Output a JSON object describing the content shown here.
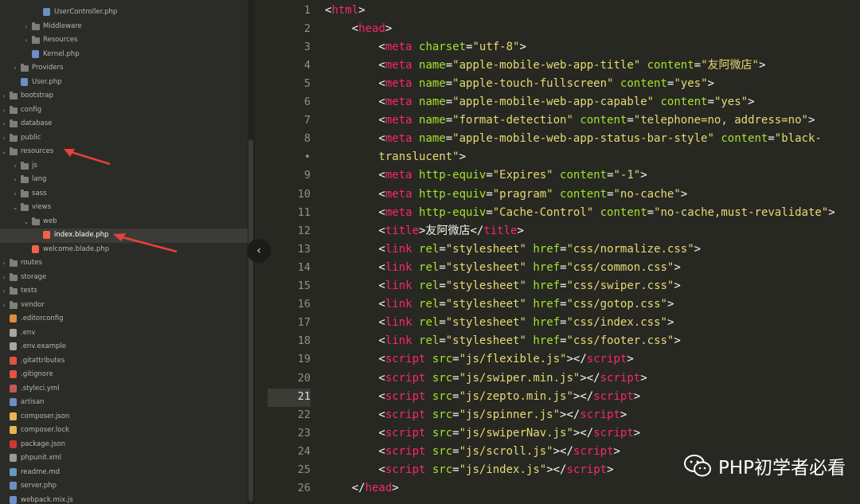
{
  "sidebar": {
    "items": [
      {
        "label": "UserController.php",
        "icon": "php-file-icon",
        "indent": 4,
        "arrow": "",
        "selected": false
      },
      {
        "label": "Middleware",
        "icon": "folder-icon",
        "indent": 3,
        "arrow": "right",
        "selected": false
      },
      {
        "label": "Resources",
        "icon": "folder-icon",
        "indent": 3,
        "arrow": "right",
        "selected": false
      },
      {
        "label": "Kernel.php",
        "icon": "php-file-icon",
        "indent": 3,
        "arrow": "",
        "selected": false
      },
      {
        "label": "Providers",
        "icon": "folder-icon",
        "indent": 2,
        "arrow": "right",
        "selected": false
      },
      {
        "label": "User.php",
        "icon": "php-file-icon",
        "indent": 2,
        "arrow": "",
        "selected": false
      },
      {
        "label": "bootstrap",
        "icon": "folder-icon",
        "indent": 1,
        "arrow": "right",
        "selected": false
      },
      {
        "label": "config",
        "icon": "folder-icon",
        "indent": 1,
        "arrow": "right",
        "selected": false
      },
      {
        "label": "database",
        "icon": "folder-icon",
        "indent": 1,
        "arrow": "right",
        "selected": false
      },
      {
        "label": "public",
        "icon": "folder-icon",
        "indent": 1,
        "arrow": "right",
        "selected": false
      },
      {
        "label": "resources",
        "icon": "folder-icon",
        "indent": 1,
        "arrow": "down",
        "selected": false
      },
      {
        "label": "js",
        "icon": "folder-icon",
        "indent": 2,
        "arrow": "right",
        "selected": false
      },
      {
        "label": "lang",
        "icon": "folder-icon",
        "indent": 2,
        "arrow": "right",
        "selected": false
      },
      {
        "label": "sass",
        "icon": "folder-icon",
        "indent": 2,
        "arrow": "right",
        "selected": false
      },
      {
        "label": "views",
        "icon": "folder-icon",
        "indent": 2,
        "arrow": "down",
        "selected": false
      },
      {
        "label": "web",
        "icon": "folder-icon",
        "indent": 3,
        "arrow": "down",
        "selected": false
      },
      {
        "label": "index.blade.php",
        "icon": "blade-file-icon",
        "indent": 4,
        "arrow": "",
        "selected": true
      },
      {
        "label": "welcome.blade.php",
        "icon": "blade-file-icon",
        "indent": 3,
        "arrow": "",
        "selected": false
      },
      {
        "label": "routes",
        "icon": "folder-icon",
        "indent": 1,
        "arrow": "right",
        "selected": false
      },
      {
        "label": "storage",
        "icon": "folder-icon",
        "indent": 1,
        "arrow": "right",
        "selected": false
      },
      {
        "label": "tests",
        "icon": "folder-icon",
        "indent": 1,
        "arrow": "right",
        "selected": false
      },
      {
        "label": "vendor",
        "icon": "folder-icon",
        "indent": 1,
        "arrow": "right",
        "selected": false
      },
      {
        "label": ".editorconfig",
        "icon": "editorconfig-icon",
        "indent": 1,
        "arrow": "",
        "selected": false
      },
      {
        "label": ".env",
        "icon": "gear-icon",
        "indent": 1,
        "arrow": "",
        "selected": false
      },
      {
        "label": ".env.example",
        "icon": "gear-icon",
        "indent": 1,
        "arrow": "",
        "selected": false
      },
      {
        "label": ".gitattributes",
        "icon": "git-icon",
        "indent": 1,
        "arrow": "",
        "selected": false
      },
      {
        "label": ".gitignore",
        "icon": "git-icon",
        "indent": 1,
        "arrow": "",
        "selected": false
      },
      {
        "label": ".styleci.yml",
        "icon": "yml-icon",
        "indent": 1,
        "arrow": "",
        "selected": false
      },
      {
        "label": "artisan",
        "icon": "php-file-icon",
        "indent": 1,
        "arrow": "",
        "selected": false
      },
      {
        "label": "composer.json",
        "icon": "composer-icon",
        "indent": 1,
        "arrow": "",
        "selected": false
      },
      {
        "label": "composer.lock",
        "icon": "composer-icon",
        "indent": 1,
        "arrow": "",
        "selected": false
      },
      {
        "label": "package.json",
        "icon": "npm-icon",
        "indent": 1,
        "arrow": "",
        "selected": false
      },
      {
        "label": "phpunit.xml",
        "icon": "xml-icon",
        "indent": 1,
        "arrow": "",
        "selected": false
      },
      {
        "label": "readme.md",
        "icon": "markdown-icon",
        "indent": 1,
        "arrow": "",
        "selected": false
      },
      {
        "label": "server.php",
        "icon": "php-file-icon",
        "indent": 1,
        "arrow": "",
        "selected": false
      },
      {
        "label": "webpack.mix.js",
        "icon": "php-file-icon",
        "indent": 1,
        "arrow": "",
        "selected": false
      }
    ]
  },
  "editor": {
    "current_line": "21",
    "line_numbers": [
      "1",
      "2",
      "3",
      "4",
      "5",
      "6",
      "7",
      "8",
      "•",
      "9",
      "10",
      "11",
      "12",
      "13",
      "14",
      "15",
      "16",
      "17",
      "18",
      "19",
      "20",
      "21",
      "22",
      "23",
      "24",
      "25",
      "26"
    ],
    "lines": [
      [
        [
          "p",
          "<"
        ],
        [
          "t",
          "html"
        ],
        [
          "p",
          ">"
        ]
      ],
      [
        [
          "p",
          "    <"
        ],
        [
          "t",
          "head"
        ],
        [
          "p",
          ">"
        ]
      ],
      [
        [
          "p",
          "        <"
        ],
        [
          "t",
          "meta"
        ],
        [
          "p",
          " "
        ],
        [
          "a",
          "charset"
        ],
        [
          "p",
          "="
        ],
        [
          "s",
          "\"utf-8\""
        ],
        [
          "p",
          ">"
        ]
      ],
      [
        [
          "p",
          "        <"
        ],
        [
          "t",
          "meta"
        ],
        [
          "p",
          " "
        ],
        [
          "a",
          "name"
        ],
        [
          "p",
          "="
        ],
        [
          "s",
          "\"apple-mobile-web-app-title\""
        ],
        [
          "p",
          " "
        ],
        [
          "a",
          "content"
        ],
        [
          "p",
          "="
        ],
        [
          "s",
          "\"友阿微店\""
        ],
        [
          "p",
          ">"
        ]
      ],
      [
        [
          "p",
          "        <"
        ],
        [
          "t",
          "meta"
        ],
        [
          "p",
          " "
        ],
        [
          "a",
          "name"
        ],
        [
          "p",
          "="
        ],
        [
          "s",
          "\"apple-touch-fullscreen\""
        ],
        [
          "p",
          " "
        ],
        [
          "a",
          "content"
        ],
        [
          "p",
          "="
        ],
        [
          "s",
          "\"yes\""
        ],
        [
          "p",
          ">"
        ]
      ],
      [
        [
          "p",
          "        <"
        ],
        [
          "t",
          "meta"
        ],
        [
          "p",
          " "
        ],
        [
          "a",
          "name"
        ],
        [
          "p",
          "="
        ],
        [
          "s",
          "\"apple-mobile-web-app-capable\""
        ],
        [
          "p",
          " "
        ],
        [
          "a",
          "content"
        ],
        [
          "p",
          "="
        ],
        [
          "s",
          "\"yes\""
        ],
        [
          "p",
          ">"
        ]
      ],
      [
        [
          "p",
          "        <"
        ],
        [
          "t",
          "meta"
        ],
        [
          "p",
          " "
        ],
        [
          "a",
          "name"
        ],
        [
          "p",
          "="
        ],
        [
          "s",
          "\"format-detection\""
        ],
        [
          "p",
          " "
        ],
        [
          "a",
          "content"
        ],
        [
          "p",
          "="
        ],
        [
          "s",
          "\"telephone=no, address=no\""
        ],
        [
          "p",
          ">"
        ]
      ],
      [
        [
          "p",
          "        <"
        ],
        [
          "t",
          "meta"
        ],
        [
          "p",
          " "
        ],
        [
          "a",
          "name"
        ],
        [
          "p",
          "="
        ],
        [
          "s",
          "\"apple-mobile-web-app-status-bar-style\""
        ],
        [
          "p",
          " "
        ],
        [
          "a",
          "content"
        ],
        [
          "p",
          "="
        ],
        [
          "s",
          "\"black-"
        ]
      ],
      [
        [
          "s",
          "        translucent\""
        ],
        [
          "p",
          ">"
        ]
      ],
      [
        [
          "p",
          "        <"
        ],
        [
          "t",
          "meta"
        ],
        [
          "p",
          " "
        ],
        [
          "a",
          "http-equiv"
        ],
        [
          "p",
          "="
        ],
        [
          "s",
          "\"Expires\""
        ],
        [
          "p",
          " "
        ],
        [
          "a",
          "content"
        ],
        [
          "p",
          "="
        ],
        [
          "s",
          "\"-1\""
        ],
        [
          "p",
          ">"
        ]
      ],
      [
        [
          "p",
          "        <"
        ],
        [
          "t",
          "meta"
        ],
        [
          "p",
          " "
        ],
        [
          "a",
          "http-equiv"
        ],
        [
          "p",
          "="
        ],
        [
          "s",
          "\"pragram\""
        ],
        [
          "p",
          " "
        ],
        [
          "a",
          "content"
        ],
        [
          "p",
          "="
        ],
        [
          "s",
          "\"no-cache\""
        ],
        [
          "p",
          ">"
        ]
      ],
      [
        [
          "p",
          "        <"
        ],
        [
          "t",
          "meta"
        ],
        [
          "p",
          " "
        ],
        [
          "a",
          "http-equiv"
        ],
        [
          "p",
          "="
        ],
        [
          "s",
          "\"Cache-Control\""
        ],
        [
          "p",
          " "
        ],
        [
          "a",
          "content"
        ],
        [
          "p",
          "="
        ],
        [
          "s",
          "\"no-cache,must-revalidate\""
        ],
        [
          "p",
          ">"
        ]
      ],
      [
        [
          "p",
          "        <"
        ],
        [
          "t",
          "title"
        ],
        [
          "p",
          ">友阿微店</"
        ],
        [
          "t",
          "title"
        ],
        [
          "p",
          ">"
        ]
      ],
      [
        [
          "p",
          "        <"
        ],
        [
          "t",
          "link"
        ],
        [
          "p",
          " "
        ],
        [
          "a",
          "rel"
        ],
        [
          "p",
          "="
        ],
        [
          "s",
          "\"stylesheet\""
        ],
        [
          "p",
          " "
        ],
        [
          "a",
          "href"
        ],
        [
          "p",
          "="
        ],
        [
          "s",
          "\"css/normalize.css\""
        ],
        [
          "p",
          ">"
        ]
      ],
      [
        [
          "p",
          "        <"
        ],
        [
          "t",
          "link"
        ],
        [
          "p",
          " "
        ],
        [
          "a",
          "rel"
        ],
        [
          "p",
          "="
        ],
        [
          "s",
          "\"stylesheet\""
        ],
        [
          "p",
          " "
        ],
        [
          "a",
          "href"
        ],
        [
          "p",
          "="
        ],
        [
          "s",
          "\"css/common.css\""
        ],
        [
          "p",
          ">"
        ]
      ],
      [
        [
          "p",
          "        <"
        ],
        [
          "t",
          "link"
        ],
        [
          "p",
          " "
        ],
        [
          "a",
          "rel"
        ],
        [
          "p",
          "="
        ],
        [
          "s",
          "\"stylesheet\""
        ],
        [
          "p",
          " "
        ],
        [
          "a",
          "href"
        ],
        [
          "p",
          "="
        ],
        [
          "s",
          "\"css/swiper.css\""
        ],
        [
          "p",
          ">"
        ]
      ],
      [
        [
          "p",
          "        <"
        ],
        [
          "t",
          "link"
        ],
        [
          "p",
          " "
        ],
        [
          "a",
          "rel"
        ],
        [
          "p",
          "="
        ],
        [
          "s",
          "\"stylesheet\""
        ],
        [
          "p",
          " "
        ],
        [
          "a",
          "href"
        ],
        [
          "p",
          "="
        ],
        [
          "s",
          "\"css/gotop.css\""
        ],
        [
          "p",
          ">"
        ]
      ],
      [
        [
          "p",
          "        <"
        ],
        [
          "t",
          "link"
        ],
        [
          "p",
          " "
        ],
        [
          "a",
          "rel"
        ],
        [
          "p",
          "="
        ],
        [
          "s",
          "\"stylesheet\""
        ],
        [
          "p",
          " "
        ],
        [
          "a",
          "href"
        ],
        [
          "p",
          "="
        ],
        [
          "s",
          "\"css/index.css\""
        ],
        [
          "p",
          ">"
        ]
      ],
      [
        [
          "p",
          "        <"
        ],
        [
          "t",
          "link"
        ],
        [
          "p",
          " "
        ],
        [
          "a",
          "rel"
        ],
        [
          "p",
          "="
        ],
        [
          "s",
          "\"stylesheet\""
        ],
        [
          "p",
          " "
        ],
        [
          "a",
          "href"
        ],
        [
          "p",
          "="
        ],
        [
          "s",
          "\"css/footer.css\""
        ],
        [
          "p",
          ">"
        ]
      ],
      [
        [
          "p",
          "        <"
        ],
        [
          "t",
          "script"
        ],
        [
          "p",
          " "
        ],
        [
          "a",
          "src"
        ],
        [
          "p",
          "="
        ],
        [
          "s",
          "\"js/flexible.js\""
        ],
        [
          "p",
          "></"
        ],
        [
          "t",
          "script"
        ],
        [
          "p",
          ">"
        ]
      ],
      [
        [
          "p",
          "        <"
        ],
        [
          "t",
          "script"
        ],
        [
          "p",
          " "
        ],
        [
          "a",
          "src"
        ],
        [
          "p",
          "="
        ],
        [
          "s",
          "\"js/swiper.min.js\""
        ],
        [
          "p",
          "></"
        ],
        [
          "t",
          "script"
        ],
        [
          "p",
          ">"
        ]
      ],
      [
        [
          "p",
          "        <"
        ],
        [
          "t",
          "script"
        ],
        [
          "p",
          " "
        ],
        [
          "a",
          "src"
        ],
        [
          "p",
          "="
        ],
        [
          "s",
          "\"js/zepto.min.js\""
        ],
        [
          "p",
          "></"
        ],
        [
          "t",
          "script"
        ],
        [
          "p",
          ">"
        ]
      ],
      [
        [
          "p",
          "        <"
        ],
        [
          "t",
          "script"
        ],
        [
          "p",
          " "
        ],
        [
          "a",
          "src"
        ],
        [
          "p",
          "="
        ],
        [
          "s",
          "\"js/spinner.js\""
        ],
        [
          "p",
          "></"
        ],
        [
          "t",
          "script"
        ],
        [
          "p",
          ">"
        ]
      ],
      [
        [
          "p",
          "        <"
        ],
        [
          "t",
          "script"
        ],
        [
          "p",
          " "
        ],
        [
          "a",
          "src"
        ],
        [
          "p",
          "="
        ],
        [
          "s",
          "\"js/swiperNav.js\""
        ],
        [
          "p",
          "></"
        ],
        [
          "t",
          "script"
        ],
        [
          "p",
          ">"
        ]
      ],
      [
        [
          "p",
          "        <"
        ],
        [
          "t",
          "script"
        ],
        [
          "p",
          " "
        ],
        [
          "a",
          "src"
        ],
        [
          "p",
          "="
        ],
        [
          "s",
          "\"js/scroll.js\""
        ],
        [
          "p",
          "></"
        ],
        [
          "t",
          "script"
        ],
        [
          "p",
          ">"
        ]
      ],
      [
        [
          "p",
          "        <"
        ],
        [
          "t",
          "script"
        ],
        [
          "p",
          " "
        ],
        [
          "a",
          "src"
        ],
        [
          "p",
          "="
        ],
        [
          "s",
          "\"js/index.js\""
        ],
        [
          "p",
          "></"
        ],
        [
          "t",
          "script"
        ],
        [
          "p",
          ">"
        ]
      ],
      [
        [
          "p",
          "    </"
        ],
        [
          "t",
          "head"
        ],
        [
          "p",
          ">"
        ]
      ]
    ]
  },
  "watermark": {
    "text": "PHP初学者必看",
    "icon": "wechat-icon"
  },
  "colors": {
    "tag": "#f92672",
    "attr": "#a6e22e",
    "string": "#e6db74",
    "plain": "#f8f8f2",
    "arrow": "#e8403a"
  }
}
